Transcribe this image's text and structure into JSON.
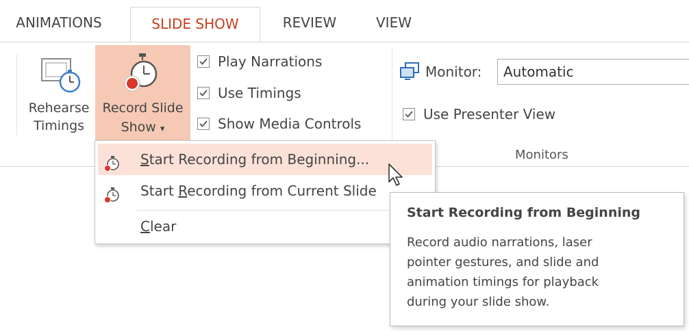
{
  "tabs": [
    {
      "label": "ANIMATIONS"
    },
    {
      "label": "SLIDE SHOW"
    },
    {
      "label": "REVIEW"
    },
    {
      "label": "VIEW"
    }
  ],
  "ribbon": {
    "rehearse": {
      "line1": "Rehearse",
      "line2": "Timings"
    },
    "record": {
      "line1": "Record Slide",
      "line2": "Show",
      "arrow": "▾"
    },
    "checkboxes": [
      {
        "label": "Play Narrations",
        "checked": true
      },
      {
        "label": "Use Timings",
        "checked": true
      },
      {
        "label": "Show Media Controls",
        "checked": true
      }
    ],
    "monitors": {
      "monitor_label": "Monitor:",
      "monitor_value": "Automatic",
      "presenter_view": {
        "label": "Use Presenter View",
        "checked": true
      },
      "group_label": "Monitors"
    }
  },
  "menu": {
    "items": [
      {
        "pre": "",
        "accel": "S",
        "post": "tart Recording from Beginning...",
        "icon": "record-timer-icon"
      },
      {
        "pre": "Start ",
        "accel": "R",
        "post": "ecording from Current Slide",
        "icon": "record-timer-icon"
      },
      {
        "pre": "",
        "accel": "C",
        "post": "lear",
        "icon": ""
      }
    ]
  },
  "tooltip": {
    "title": "Start Recording from Beginning",
    "lines": [
      "Record audio narrations, laser",
      "pointer gestures, and slide and",
      "animation timings for playback",
      "during your slide show."
    ]
  },
  "colors": {
    "accent": "#c43e1c",
    "highlight": "#f6c9b5",
    "hover": "#fbe1d7"
  }
}
